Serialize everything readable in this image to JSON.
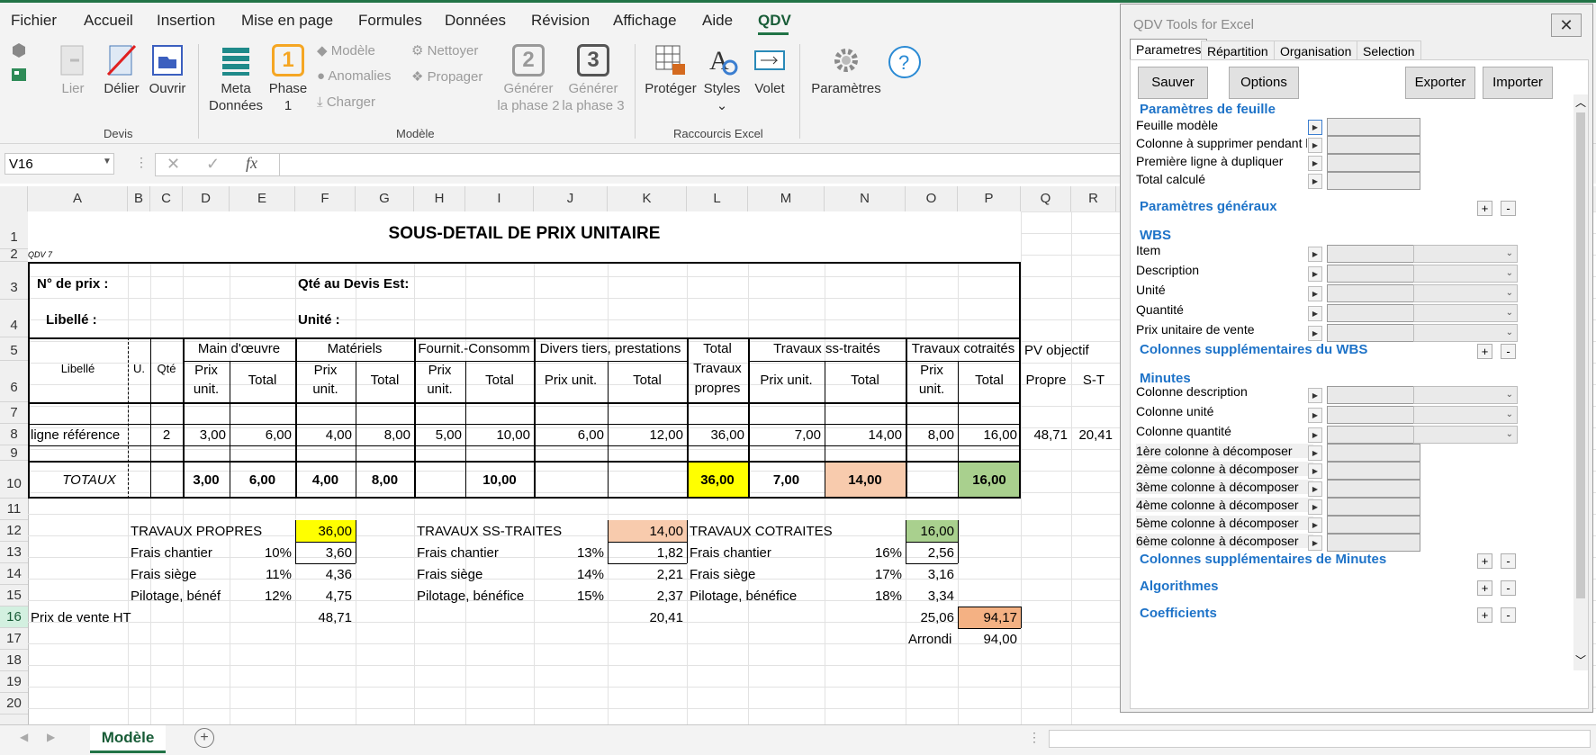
{
  "menu": [
    "Fichier",
    "Accueil",
    "Insertion",
    "Mise en page",
    "Formules",
    "Données",
    "Révision",
    "Affichage",
    "Aide",
    "QDV"
  ],
  "ribbon": {
    "devis": {
      "lier": "Lier",
      "delier": "Délier",
      "ouvrir": "Ouvrir",
      "label": "Devis"
    },
    "modele": {
      "meta": "Meta",
      "meta2": "Données",
      "phase": "Phase",
      "phase2": "1",
      "phase_num": "1",
      "modele": "Modèle",
      "anomalies": "Anomalies",
      "charger": "Charger",
      "nettoyer": "Nettoyer",
      "propager": "Propager",
      "gen2a": "Générer",
      "gen2b": "la phase 2",
      "gen2_num": "2",
      "gen3a": "Générer",
      "gen3b": "la phase 3",
      "gen3_num": "3",
      "label": "Modèle"
    },
    "raccourcis": {
      "proteger": "Protéger",
      "styles": "Styles",
      "volet": "Volet",
      "label": "Raccourcis Excel"
    },
    "parametres": "Paramètres"
  },
  "formula": {
    "name_box": "V16"
  },
  "columns": [
    "A",
    "B",
    "C",
    "D",
    "E",
    "F",
    "G",
    "H",
    "I",
    "J",
    "K",
    "L",
    "M",
    "N",
    "O",
    "P",
    "Q",
    "R"
  ],
  "rows": [
    "1",
    "2",
    "3",
    "4",
    "5",
    "6",
    "7",
    "8",
    "9",
    "10",
    "11",
    "12",
    "13",
    "14",
    "15",
    "16",
    "17",
    "18",
    "19",
    "20"
  ],
  "sheet": {
    "title": "SOUS-DETAIL DE PRIX UNITAIRE",
    "qdv7": "QDV 7",
    "no_prix": "N° de prix :",
    "qte_devis": "Qté au Devis Est:",
    "libelle_lbl": "Libellé :",
    "unite_lbl": "Unité :",
    "h_libelle": "Libellé",
    "h_u": "U.",
    "h_qte": "Qté",
    "h_mo": "Main d'œuvre",
    "h_mat": "Matériels",
    "h_fourn": "Fournit.-Consomm",
    "h_divers": "Divers tiers, prestations",
    "h_total1": "Total",
    "h_total2": "Travaux",
    "h_total3": "propres",
    "h_ss": "Travaux ss-traités",
    "h_cot": "Travaux cotraités",
    "h_pv": "PV objectif",
    "h_prix": "Prix",
    "h_unit": "unit.",
    "h_total": "Total",
    "h_prixunit": "Prix unit.",
    "h_propre": "Propre",
    "h_st": "S-T",
    "row8": [
      "ligne référence",
      "2",
      "3,00",
      "6,00",
      "4,00",
      "8,00",
      "5,00",
      "10,00",
      "6,00",
      "12,00",
      "36,00",
      "7,00",
      "14,00",
      "8,00",
      "16,00",
      "48,71",
      "20,41"
    ],
    "totaux": [
      "TOTAUX",
      "3,00",
      "6,00",
      "4,00",
      "8,00",
      "10,00",
      "36,00",
      "7,00",
      "14,00",
      "16,00"
    ],
    "tp": {
      "label": "TRAVAUX PROPRES",
      "val": "36,00",
      "fc": "Frais chantier",
      "fc_pct": "10%",
      "fc_val": "3,60",
      "fs": "Frais siège",
      "fs_pct": "11%",
      "fs_val": "4,36",
      "pb": "Pilotage, bénéf",
      "pb_pct": "12%",
      "pb_val": "4,75",
      "pv": "48,71"
    },
    "ss": {
      "label": "TRAVAUX SS-TRAITES",
      "val": "14,00",
      "fc": "Frais chantier",
      "fc_pct": "13%",
      "fc_val": "1,82",
      "fs": "Frais siège",
      "fs_pct": "14%",
      "fs_val": "2,21",
      "pb": "Pilotage, bénéfice",
      "pb_pct": "15%",
      "pb_val": "2,37",
      "pv": "20,41"
    },
    "co": {
      "label": "TRAVAUX COTRAITES",
      "val": "16,00",
      "fc": "Frais chantier",
      "fc_pct": "16%",
      "fc_val": "2,56",
      "fs": "Frais siège",
      "fs_pct": "17%",
      "fs_val": "3,16",
      "pb": "Pilotage, bénéfice",
      "pb_pct": "18%",
      "pb_val": "3,34",
      "pv": "25,06"
    },
    "pv_ht": "Prix de vente HT",
    "total": "94,17",
    "arrondi": "Arrondi",
    "arrondi_val": "94,00"
  },
  "sheet_tab": "Modèle",
  "panel": {
    "title": "QDV Tools for Excel",
    "tabs": [
      "Parametres",
      "Répartition",
      "Organisation",
      "Selection"
    ],
    "buttons": {
      "sauver": "Sauver",
      "options": "Options",
      "exporter": "Exporter",
      "importer": "Importer"
    },
    "sec_feuille": "Paramètres de feuille",
    "feuille": [
      "Feuille modèle",
      "Colonne à supprimer pendant la co",
      "Première ligne à dupliquer",
      "Total calculé"
    ],
    "sec_generaux": "Paramètres généraux",
    "sec_wbs": "WBS",
    "wbs": [
      "Item",
      "Description",
      "Unité",
      "Quantité",
      "Prix unitaire de vente"
    ],
    "sec_wbs_sup": "Colonnes supplémentaires du WBS",
    "sec_minutes": "Minutes",
    "minutes": [
      "Colonne description",
      "Colonne unité",
      "Colonne quantité"
    ],
    "decomp": [
      "1ère colonne à décomposer",
      "2ème colonne à décomposer",
      "3ème colonne à décomposer",
      "4ème colonne à décomposer",
      "5ème colonne à décomposer",
      "6ème colonne à décomposer"
    ],
    "sec_min_sup": "Colonnes supplémentaires de Minutes",
    "sec_algo": "Algorithmes",
    "sec_coef": "Coefficients",
    "plus": "+",
    "minus": "-"
  },
  "colors": {
    "yellow": "#ffff00",
    "peach": "#f8cbad",
    "green": "#a9d08e",
    "orange": "#f4b183",
    "excel_green": "#217346",
    "link_blue": "#1e73c8"
  }
}
